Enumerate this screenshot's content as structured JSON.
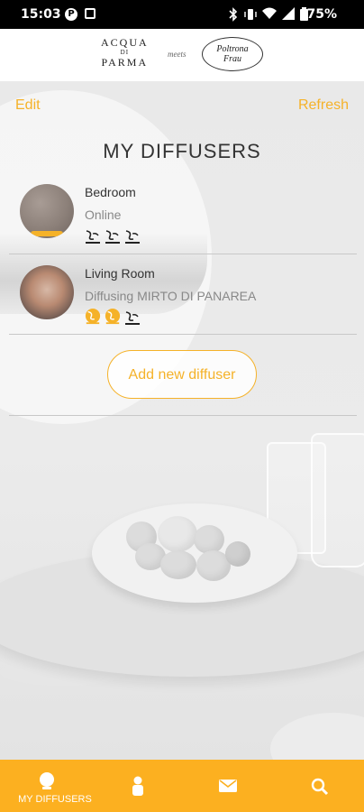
{
  "status_bar": {
    "time": "15:03",
    "battery": "75%"
  },
  "brand": {
    "left_line1": "ACQUA",
    "left_line2": "DI",
    "left_line3": "PARMA",
    "meets": "meets",
    "right_line1": "Poltrona",
    "right_line2": "Frau"
  },
  "header": {
    "edit_label": "Edit",
    "refresh_label": "Refresh",
    "title": "MY DIFFUSERS"
  },
  "diffusers": [
    {
      "name": "Bedroom",
      "status": "Online",
      "intensity": {
        "active": 0,
        "max": 3
      }
    },
    {
      "name": "Living Room",
      "status": "Diffusing MIRTO DI PANAREA",
      "intensity": {
        "active": 2,
        "max": 3
      }
    }
  ],
  "add_button": {
    "label": "Add new diffuser"
  },
  "bottom_nav": {
    "items": [
      {
        "label": "MY DIFFUSERS",
        "icon": "diffuser-icon",
        "active": true
      },
      {
        "label": "",
        "icon": "person-icon",
        "active": false
      },
      {
        "label": "",
        "icon": "mail-icon",
        "active": false
      },
      {
        "label": "",
        "icon": "search-icon",
        "active": false
      }
    ]
  },
  "colors": {
    "accent": "#f5b229",
    "nav_background": "#fcb020",
    "text_dark": "#333333",
    "text_muted": "#888888"
  }
}
